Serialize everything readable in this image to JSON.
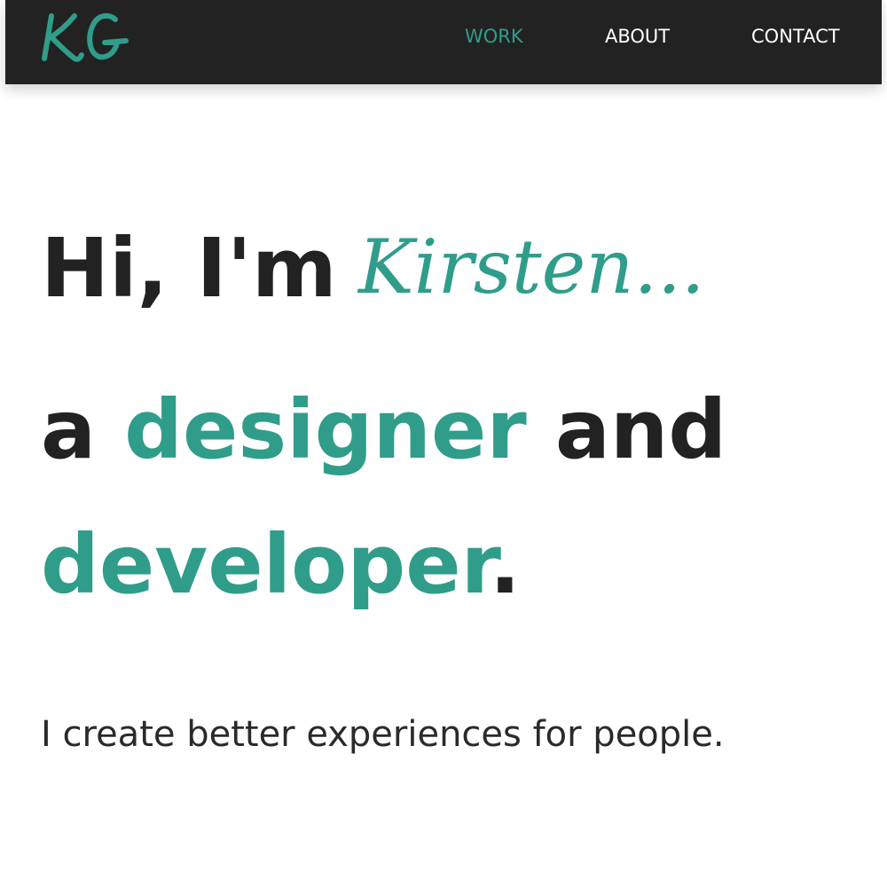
{
  "colors": {
    "accent": "#2f9d8a",
    "nav_background": "#222222",
    "text_dark": "#222222",
    "nav_text": "#ffffff",
    "page_background": "#ffffff"
  },
  "nav": {
    "logo_text": "KG",
    "items": [
      {
        "label": "WORK",
        "active": true
      },
      {
        "label": "ABOUT",
        "active": false
      },
      {
        "label": "CONTACT",
        "active": false
      }
    ]
  },
  "hero": {
    "greeting": "Hi, I'm",
    "name": "Kirsten...",
    "line2_prefix": "a",
    "line2_accent": "designer",
    "line2_suffix": "and",
    "line3_accent": "developer",
    "line3_punct": ".",
    "tagline": "I create better experiences for people."
  }
}
